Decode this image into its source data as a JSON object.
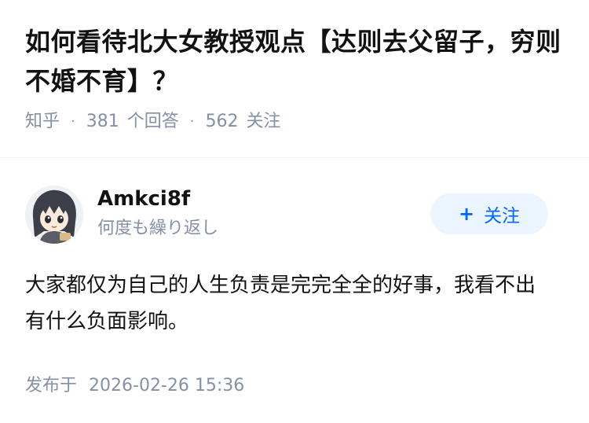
{
  "question": {
    "title": "如何看待北大女教授观点【达则去父留子，穷则不婚不育】？",
    "source": "知乎",
    "answer_count": "381",
    "answer_label": "个回答",
    "follower_count": "562",
    "follower_label": "关注"
  },
  "answer": {
    "author": {
      "name": "Amkci8f",
      "bio": "何度も繰り返し",
      "avatar_icon": "avatar-anime-girl-icon"
    },
    "follow_button": {
      "plus": "+",
      "label": "关注"
    },
    "content": "大家都仅为自己的人生负责是完完全全的好事，我看不出有什么负面影响。",
    "published_label": "发布于",
    "published_time": "2026-02-26 15:36"
  },
  "colors": {
    "text": "#121212",
    "meta": "#8590a6",
    "accent": "#0066ff",
    "accent_bg": "#ebf5ff"
  }
}
